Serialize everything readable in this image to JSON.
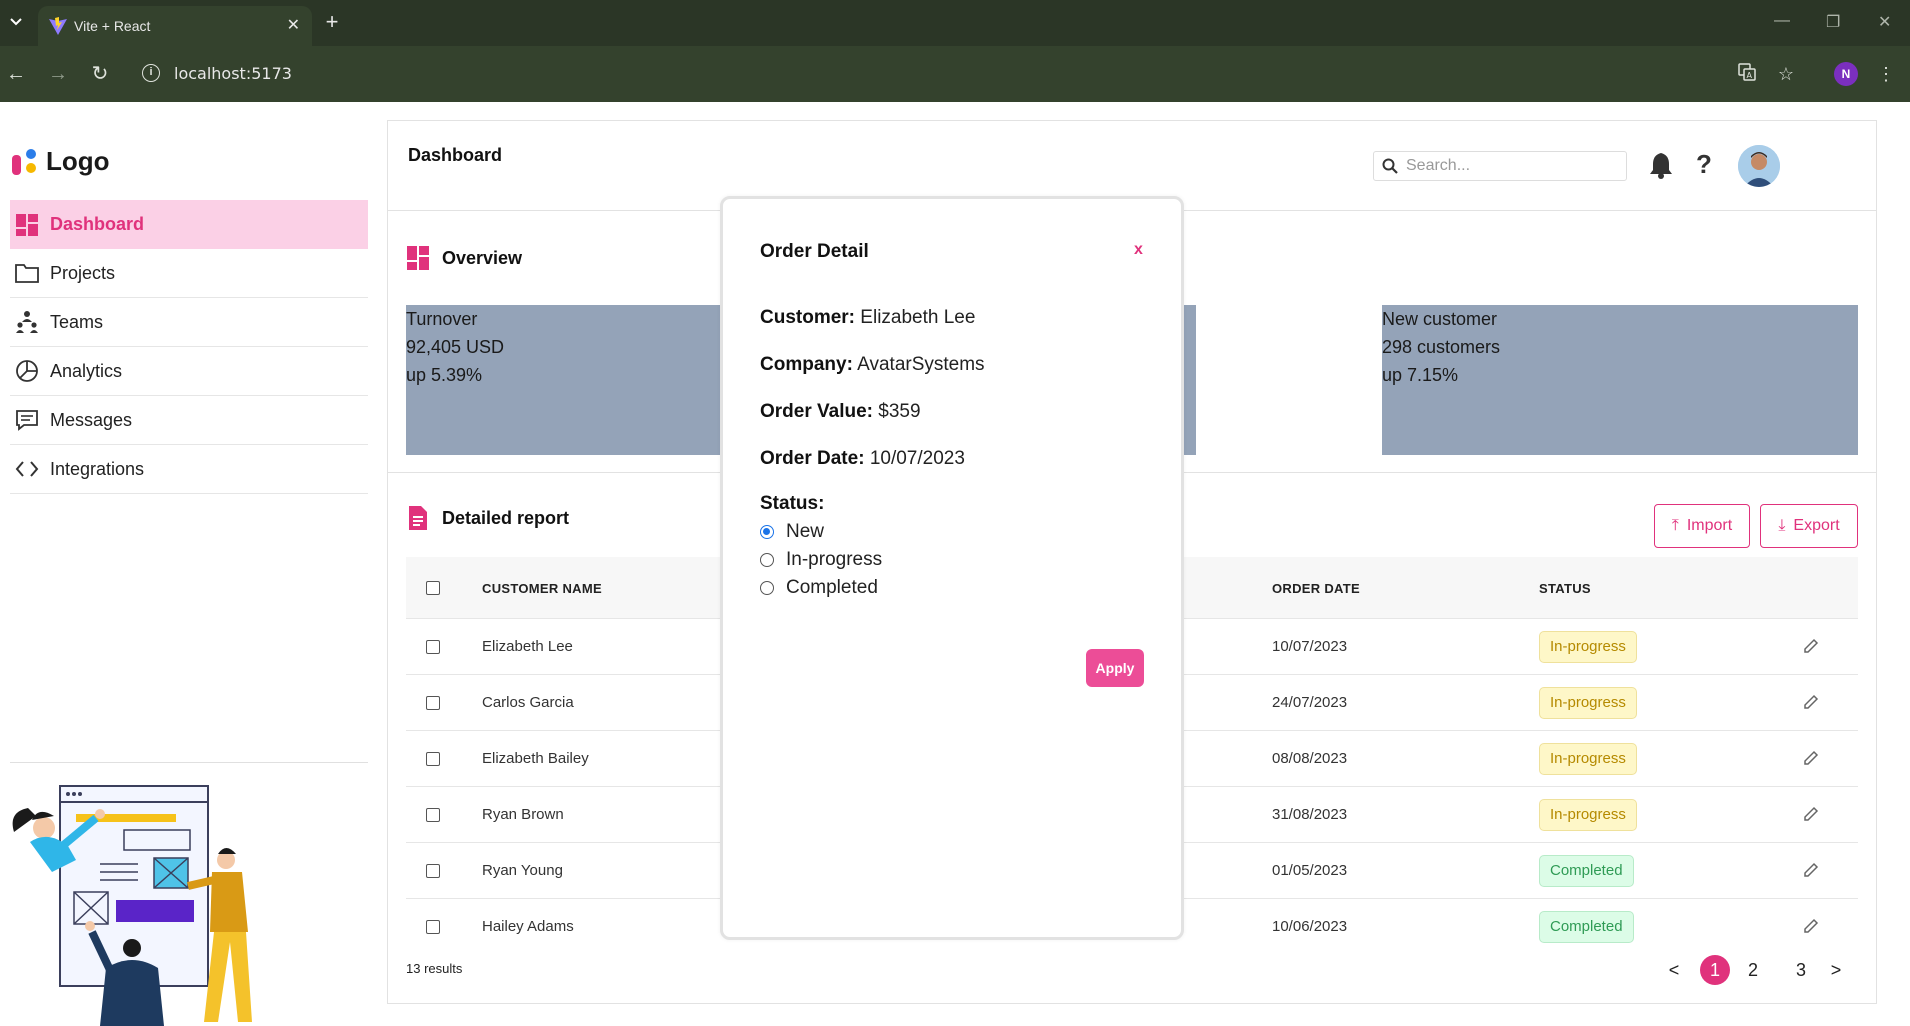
{
  "browser": {
    "tab_title": "Vite + React",
    "tab_close": "✕",
    "new_tab": "+",
    "url": "localhost:5173",
    "profile_initial": "N"
  },
  "sidebar": {
    "logo_text": "Logo",
    "items": [
      {
        "label": "Dashboard",
        "icon": "dashboard-icon",
        "active": true
      },
      {
        "label": "Projects",
        "icon": "folder-icon"
      },
      {
        "label": "Teams",
        "icon": "team-icon"
      },
      {
        "label": "Analytics",
        "icon": "pie-chart-icon"
      },
      {
        "label": "Messages",
        "icon": "message-icon"
      },
      {
        "label": "Integrations",
        "icon": "code-icon"
      }
    ]
  },
  "header": {
    "title": "Dashboard",
    "search_placeholder": "Search...",
    "help": "?"
  },
  "overview": {
    "title": "Overview",
    "cards": [
      {
        "label": "Turnover",
        "value": "92,405 USD",
        "change": "up 5.39%"
      },
      {
        "label": "New customer",
        "value": "298 customers",
        "change": "up 7.15%"
      }
    ]
  },
  "report": {
    "title": "Detailed report",
    "import_label": "Import",
    "export_label": "Export",
    "columns": [
      "CUSTOMER NAME",
      "ORDER DATE",
      "STATUS"
    ],
    "rows": [
      {
        "customer": "Elizabeth Lee",
        "date": "10/07/2023",
        "status": "In-progress"
      },
      {
        "customer": "Carlos Garcia",
        "date": "24/07/2023",
        "status": "In-progress"
      },
      {
        "customer": "Elizabeth Bailey",
        "date": "08/08/2023",
        "status": "In-progress"
      },
      {
        "customer": "Ryan Brown",
        "date": "31/08/2023",
        "status": "In-progress"
      },
      {
        "customer": "Ryan Young",
        "date": "01/05/2023",
        "status": "Completed"
      },
      {
        "customer": "Hailey Adams",
        "date": "10/06/2023",
        "status": "Completed"
      }
    ],
    "results": "13 results",
    "pagination": {
      "prev": "<",
      "pages": [
        "1",
        "2",
        "3"
      ],
      "current": "1",
      "next": ">"
    }
  },
  "modal": {
    "title": "Order Detail",
    "close": "x",
    "customer_label": "Customer:",
    "customer_value": "Elizabeth Lee",
    "company_label": "Company:",
    "company_value": "AvatarSystems",
    "order_value_label": "Order Value:",
    "order_value": "$359",
    "order_date_label": "Order Date:",
    "order_date": "10/07/2023",
    "status_label": "Status:",
    "status_options": [
      "New",
      "In-progress",
      "Completed"
    ],
    "selected_status": "New",
    "apply_label": "Apply"
  },
  "colors": {
    "brand": "#e0327c",
    "active_bg": "#fbd0e6",
    "card_bg": "#94a3b8",
    "chrome_bg": "#2b3626"
  }
}
